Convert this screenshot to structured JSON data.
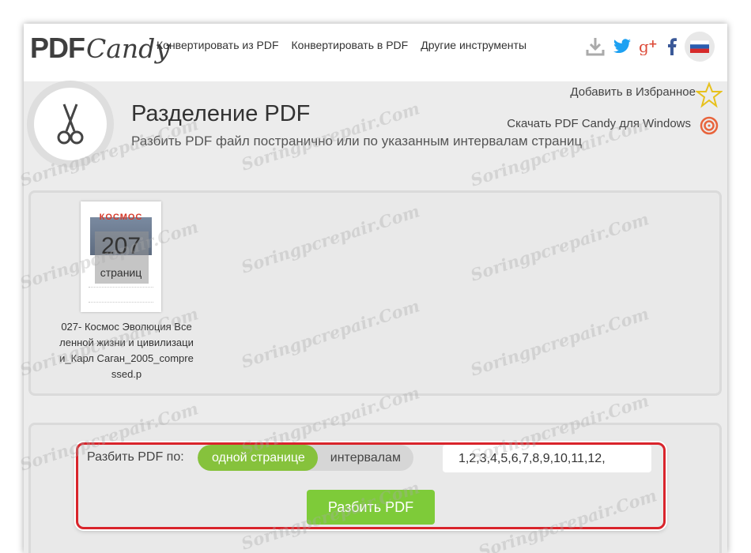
{
  "brand": {
    "logo_pdf": "PDF",
    "logo_candy": "Candy"
  },
  "nav": [
    {
      "label": "Конвертировать из PDF"
    },
    {
      "label": "Конвертировать в PDF"
    },
    {
      "label": "Другие инструменты"
    }
  ],
  "header_icons": [
    "download-icon",
    "twitter-icon",
    "google-plus-icon",
    "facebook-icon",
    "russia-flag-icon"
  ],
  "page": {
    "title": "Разделение PDF",
    "subtitle": "Разбить PDF файл постранично или по указанным интервалам страниц",
    "favorites_link": "Добавить в Избранное",
    "windows_link": "Скачать PDF Candy для Windows"
  },
  "file": {
    "thumb_title": "КОСМОС",
    "page_count": "207",
    "page_count_label": "страниц",
    "name": "027- Космос Эволюция Вселенной жизни и цивилизации_Карл Саган_2005_compressed.p"
  },
  "split": {
    "label": "Разбить PDF по:",
    "option_pages": "одной странице",
    "option_intervals": "интервалам",
    "pages_value": "1,2,3,4,5,6,7,8,9,10,11,12,",
    "button_label": "Разбить PDF"
  },
  "colors": {
    "accent_green": "#86c23c",
    "button_green": "#7ecb39",
    "highlight_red": "#d9242b",
    "twitter_blue": "#1da1f2",
    "google_red": "#dd4b39",
    "facebook_blue": "#3b5998"
  },
  "watermark": "Soringpcrepair.Com"
}
